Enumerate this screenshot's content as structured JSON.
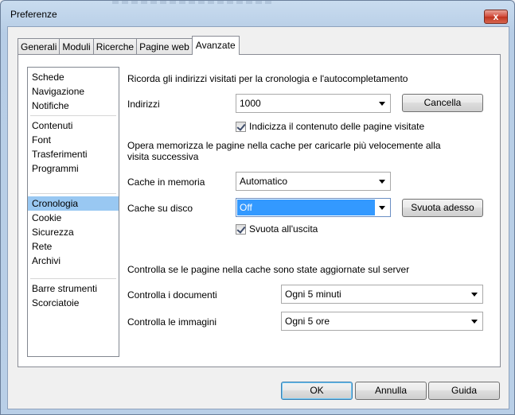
{
  "window": {
    "title": "Preferenze",
    "close_glyph": "x"
  },
  "tabs": [
    {
      "label": "Generali"
    },
    {
      "label": "Moduli"
    },
    {
      "label": "Ricerche"
    },
    {
      "label": "Pagine web"
    },
    {
      "label": "Avanzate",
      "active": true
    }
  ],
  "sidebar": {
    "groups": [
      [
        "Schede",
        "Navigazione",
        "Notifiche"
      ],
      [
        "Contenuti",
        "Font",
        "Trasferimenti",
        "Programmi"
      ],
      [
        "Cronologia",
        "Cookie",
        "Sicurezza",
        "Rete",
        "Archivi"
      ],
      [
        "Barre strumenti",
        "Scorciatoie"
      ]
    ],
    "selected": "Cronologia"
  },
  "history": {
    "heading": "Ricorda gli indirizzi visitati per la cronologia e l'autocompletamento",
    "addresses_label": "Indirizzi",
    "addresses_value": "1000",
    "clear_button": "Cancella",
    "index_checkbox": "Indicizza il contenuto delle pagine visitate",
    "index_checked": true
  },
  "cache": {
    "heading": "Opera memorizza le pagine nella cache per caricarle più velocemente alla visita successiva",
    "memory_label": "Cache in memoria",
    "memory_value": "Automatico",
    "disk_label": "Cache su disco",
    "disk_value": "Off",
    "empty_now_button": "Svuota adesso",
    "empty_on_exit_checkbox": "Svuota all'uscita",
    "empty_on_exit_checked": true
  },
  "check": {
    "heading": "Controlla se le pagine nella cache sono state aggiornate sul server",
    "documents_label": "Controlla i documenti",
    "documents_value": "Ogni 5 minuti",
    "images_label": "Controlla le immagini",
    "images_value": "Ogni 5 ore"
  },
  "footer": {
    "ok": "OK",
    "cancel": "Annulla",
    "help": "Guida"
  },
  "colors": {
    "selection": "#99c8f2",
    "focus_fill": "#3399ff",
    "close_red": "#c0341f"
  }
}
